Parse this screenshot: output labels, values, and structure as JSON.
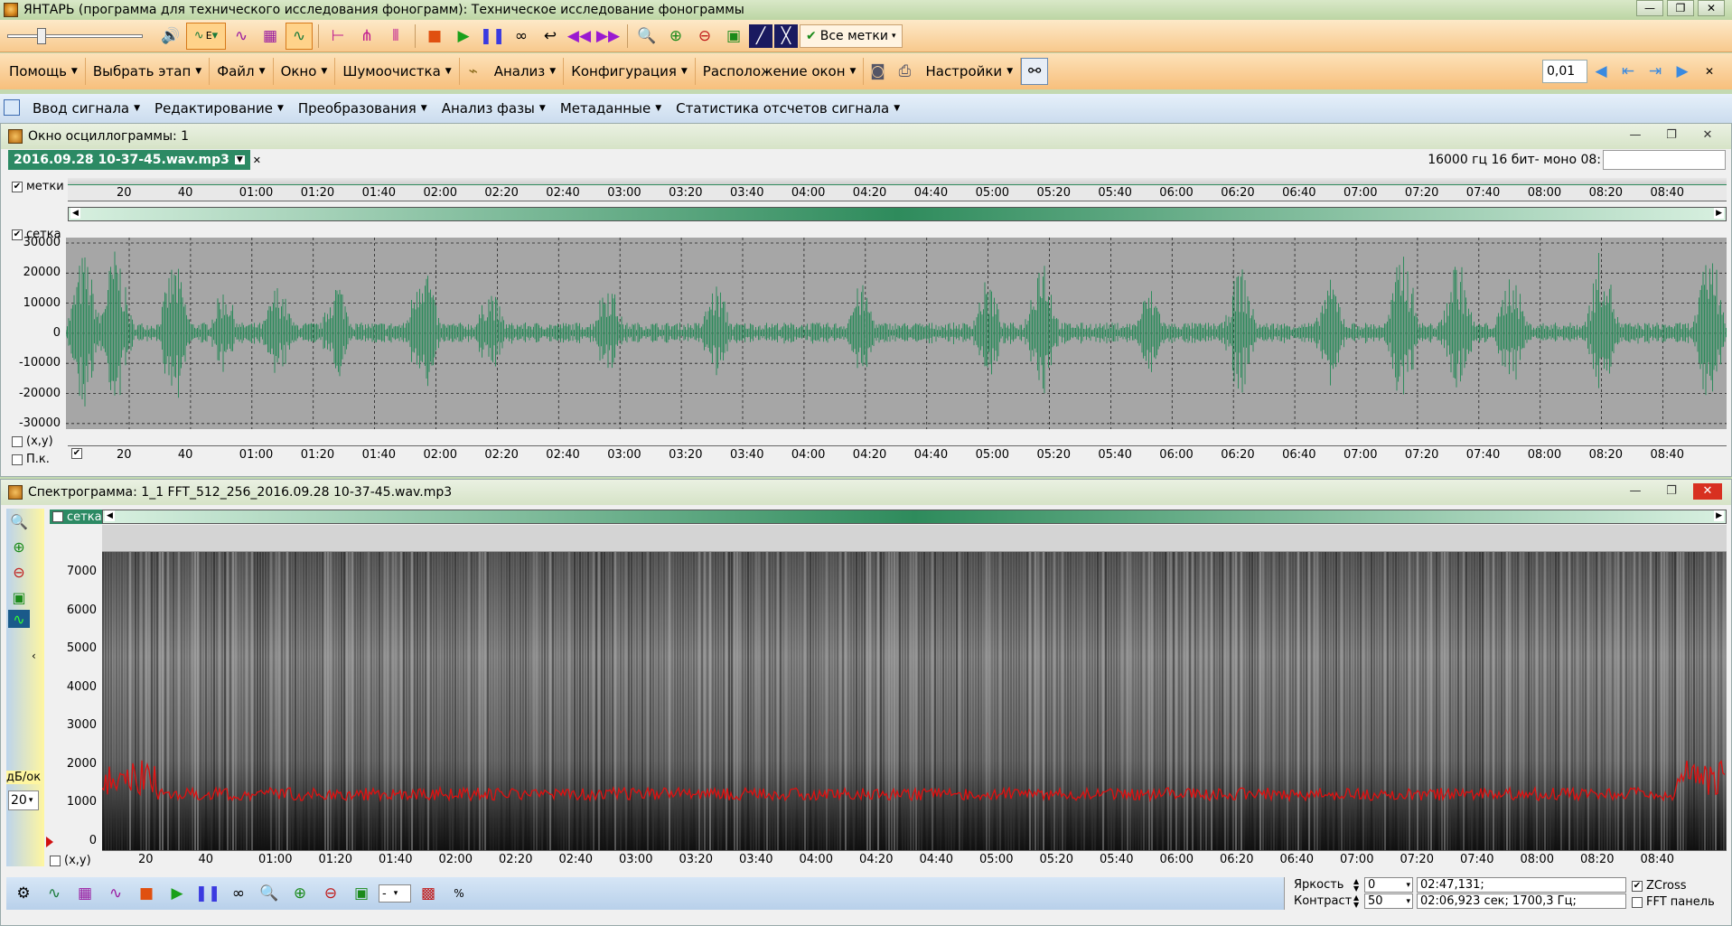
{
  "window": {
    "title": "ЯНТАРЬ (программа для технического исследования фонограмм): Техническое исследование фонограммы",
    "controls": [
      "—",
      "❐",
      "✕"
    ]
  },
  "toolbar": {
    "icons": [
      "speaker-icon",
      "waveform-edit-icon",
      "waveform-icon",
      "waveform-box-icon",
      "waveform-active-icon",
      "marker-add-icon",
      "marker-multi-icon",
      "marker-range-icon",
      "stop-icon",
      "play-icon",
      "pause-icon",
      "loop-icon",
      "return-icon",
      "rewind-icon",
      "forward-icon",
      "zoom-tool-icon",
      "zoom-in-icon",
      "zoom-out-icon",
      "zoom-fit-icon",
      "spectrum-icon",
      "spectrum-alt-icon"
    ],
    "all_marks_label": "Все метки",
    "wave_combo_label": "E"
  },
  "menubar": {
    "items": [
      "Помощь",
      "Выбрать этап",
      "Файл",
      "Окно",
      "Шумоочистка",
      "Анализ",
      "Конфигурация",
      "Расположение окон",
      "Настройки"
    ],
    "step_value": "0,01"
  },
  "menubar2": {
    "items": [
      "Ввод сигнала",
      "Редактирование",
      "Преобразования",
      "Анализ фазы",
      "Метаданные",
      "Статистика отсчетов сигнала"
    ]
  },
  "osc": {
    "title": "Окно осциллограммы: 1",
    "tab_label": "2016.09.28 10-37-45.wav.mp3",
    "format_info": "16000 гц 16 бит- моно 08:",
    "format_field": "",
    "marks_label": "метки",
    "grid_label": "сетка",
    "xy_label": "(x,y)",
    "pk_label": "П.к.",
    "y_ticks": [
      "30000",
      "20000",
      "10000",
      "0",
      "-10000",
      "-20000",
      "-30000"
    ],
    "x_ticks": [
      "20",
      "40",
      "01:00",
      "01:20",
      "01:40",
      "02:00",
      "02:20",
      "02:40",
      "03:00",
      "03:20",
      "03:40",
      "04:00",
      "04:20",
      "04:40",
      "05:00",
      "05:20",
      "05:40",
      "06:00",
      "06:20",
      "06:40",
      "07:00",
      "07:20",
      "07:40",
      "08:00",
      "08:20",
      "08:40"
    ]
  },
  "spec": {
    "title": "Спектрограмма: 1_1  FFT_512_256_2016.09.28 10-37-45.wav.mp3",
    "grid_label": "сетка",
    "y_ticks": [
      "7000",
      "6000",
      "5000",
      "4000",
      "3000",
      "2000",
      "1000",
      "0"
    ],
    "x_ticks": [
      "20",
      "40",
      "01:00",
      "01:20",
      "01:40",
      "02:00",
      "02:20",
      "02:40",
      "03:00",
      "03:20",
      "03:40",
      "04:00",
      "04:20",
      "04:40",
      "05:00",
      "05:20",
      "05:40",
      "06:00",
      "06:20",
      "06:40",
      "07:00",
      "07:20",
      "07:40",
      "08:00",
      "08:20",
      "08:40"
    ],
    "db_label": "дБ/ок",
    "db_value": "20",
    "xy_label": "(x,y)",
    "brightness_label": "Яркость",
    "brightness_value": "0",
    "contrast_label": "Контраст",
    "contrast_value": "50",
    "readout1": "02:47,131;",
    "readout2": "02:06,923 сек; 1700,3 Гц;",
    "zcross_label": "ZCross",
    "fft_panel_label": "FFT панель",
    "bottom_combo": "-",
    "pct_label": "%"
  },
  "colors": {
    "wave": "#2e8b5c",
    "spec_line": "#e01010",
    "accent_orange": "#f8c98d"
  }
}
